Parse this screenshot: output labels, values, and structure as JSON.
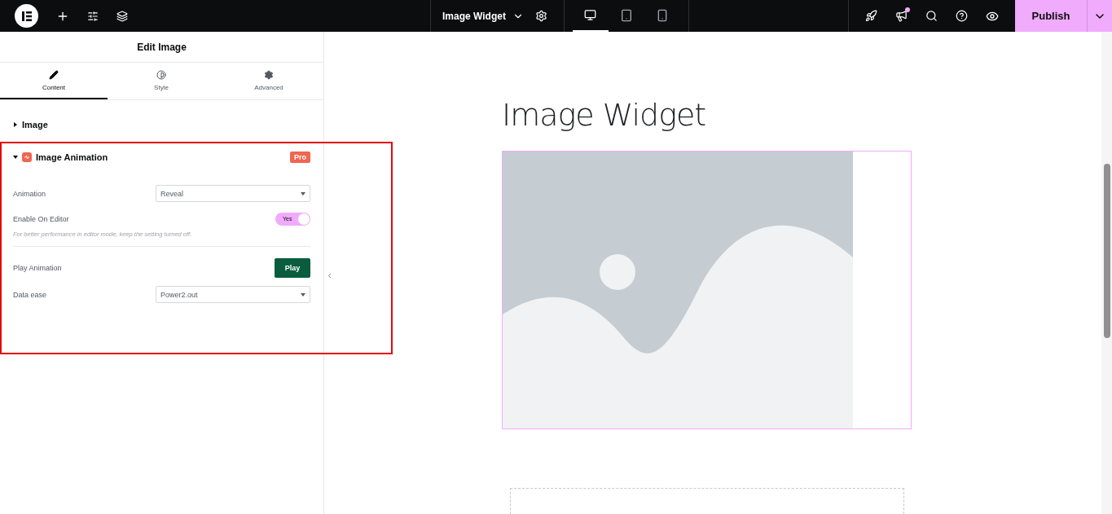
{
  "topbar": {
    "document": "Image Widget",
    "devices": [
      {
        "kind": "desktop",
        "selected": true
      },
      {
        "kind": "tablet",
        "selected": false
      },
      {
        "kind": "mobile",
        "selected": false
      }
    ],
    "notification": true,
    "publish": "Publish"
  },
  "panel": {
    "title": "Edit Image",
    "tabs": [
      {
        "kind": "content",
        "label": "Content",
        "selected": true
      },
      {
        "kind": "style",
        "label": "Style",
        "selected": false
      },
      {
        "kind": "advanced",
        "label": "Advanced",
        "selected": false
      }
    ],
    "sections": [
      {
        "title": "Image",
        "expanded": false
      },
      {
        "title": "Image Animation",
        "expanded": true,
        "highlighted": true,
        "badge": "Pro",
        "controls": [
          {
            "kind": "select",
            "label": "Animation",
            "value": "Reveal"
          },
          {
            "kind": "switch",
            "label": "Enable On Editor",
            "on": true,
            "switch_text": "Yes"
          },
          {
            "kind": "note",
            "text": "For better performance in editor mode, keep the setting turned off."
          },
          {
            "kind": "divider"
          },
          {
            "kind": "button",
            "label": "Play Animation",
            "button_text": "Play"
          },
          {
            "kind": "select",
            "label": "Data ease",
            "value": "Power2.out"
          }
        ]
      }
    ]
  },
  "canvas": {
    "heading": "Image Widget"
  }
}
